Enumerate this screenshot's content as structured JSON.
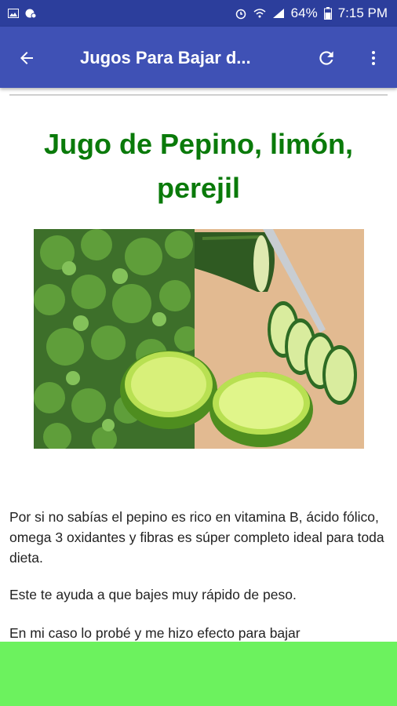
{
  "status_bar": {
    "battery": "64%",
    "time": "7:15 PM",
    "icons": [
      "image-icon",
      "chat-icon",
      "alarm-icon",
      "wifi-icon",
      "signal-icon",
      "battery-icon"
    ]
  },
  "app_bar": {
    "title": "Jugos Para Bajar d...",
    "back_icon": "arrow-left-icon",
    "refresh_icon": "refresh-icon",
    "more_icon": "more-vert-icon"
  },
  "article": {
    "title": "Jugo de Pepino, limón, perejil",
    "paragraphs": [
      "Por si no sabías el pepino es rico en vitamina B, ácido fólico, omega 3 oxidantes y fibras es súper completo ideal para toda dieta.",
      "Este te ayuda a que bajes muy rápido de peso.",
      "En mi caso lo probé y me hizo efecto para bajar"
    ]
  },
  "colors": {
    "status_bar": "#2c3e9c",
    "app_bar": "#3f51b5",
    "title_green": "#0a7a0a",
    "ad_banner": "#6cf25e"
  }
}
